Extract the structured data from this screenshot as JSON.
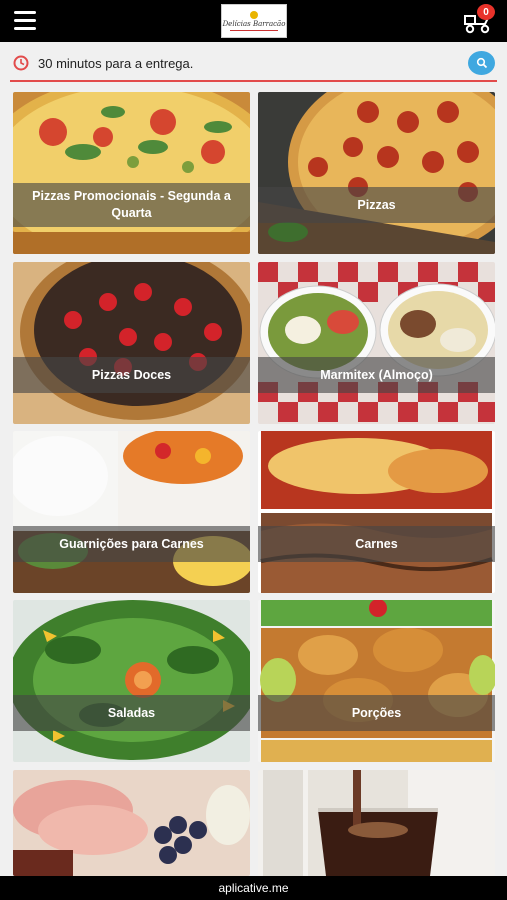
{
  "header": {
    "logo_text": "Delícias Barracão",
    "cart_count": "0"
  },
  "info": {
    "delivery_text": "30 minutos para a entrega."
  },
  "categories": [
    {
      "label": "Pizzas Promocionais - Segunda a Quarta"
    },
    {
      "label": "Pizzas"
    },
    {
      "label": "Pizzas Doces"
    },
    {
      "label": "Marmitex (Almoço)"
    },
    {
      "label": "Guarnições para Carnes"
    },
    {
      "label": "Carnes"
    },
    {
      "label": "Saladas"
    },
    {
      "label": "Porções"
    },
    {
      "label": ""
    },
    {
      "label": ""
    }
  ],
  "footer": {
    "brand": "aplicative.me"
  },
  "colors": {
    "accent_red": "#e24b4b",
    "search_blue": "#3fa8e0",
    "badge_red": "#e8322a"
  },
  "icons": {
    "menu": "hamburger-icon",
    "cart": "delivery-scooter-icon",
    "clock": "clock-icon",
    "search": "search-icon"
  }
}
